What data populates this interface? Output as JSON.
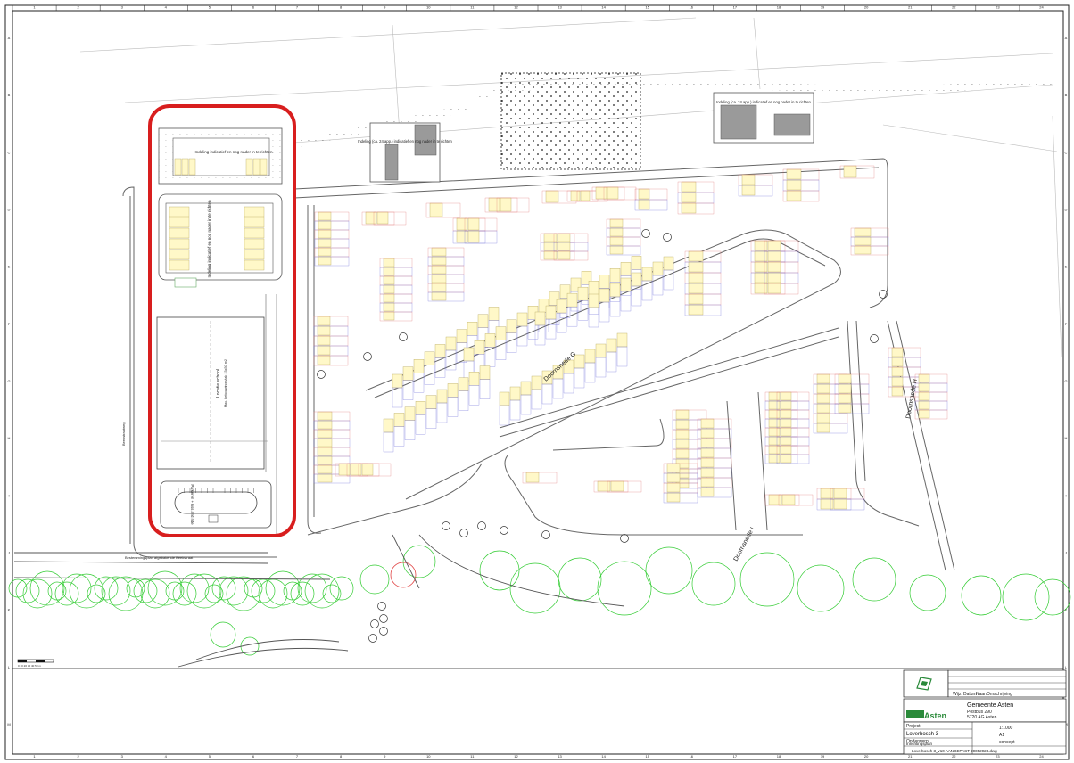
{
  "sheet": {
    "column_numbers": [
      "1",
      "2",
      "3",
      "4",
      "5",
      "6",
      "7",
      "8",
      "9",
      "10",
      "11",
      "12",
      "13",
      "14",
      "15",
      "16",
      "17",
      "18",
      "19",
      "20",
      "21",
      "22",
      "23",
      "24"
    ],
    "row_letters": [
      "A",
      "B",
      "C",
      "D",
      "E",
      "F",
      "G",
      "H",
      "I",
      "J",
      "K",
      "L",
      "M"
    ]
  },
  "labels": {
    "building_left_top": "Indeling indicatief en nog nader in te richten",
    "building_left_mid": "Indeling indicatief en nog nader in te richten",
    "school": "Locatie school",
    "school_sub": "Max. bebouwingsvlak 15x50 m2",
    "parking": "Parkeren + kiss and ride",
    "building_center": "Indeling (ca. 24 app.) indicatief en nog nader in te richten",
    "building_right": "Indeling (ca. 24 app.) indicatief en nog nader in te richten",
    "street_g": "Doornsnede G",
    "street_h": "Doornsnede H",
    "street_i": "Doornsnede I",
    "road_west": "Beekstraatweg",
    "road_south": "Bestemmingsplan afgebakende Beekstraat"
  },
  "title_block": {
    "municipality": "Gemeente Asten",
    "logo_text": "Asten",
    "project_label": "Project",
    "project": "Loverbosch 3",
    "content_label": "Onderwerp",
    "content": "Inrichtingsplan",
    "file": "Loverbosch 3_v10 AANGEPAST 20052023.dwg",
    "scale": "1:1000",
    "format": "A1",
    "status": "concept",
    "address_lines": [
      "Postbus 290",
      "5720 AG Asten"
    ],
    "revision_header": [
      "Wijz.",
      "Datum",
      "Naam",
      "Omschrijving"
    ]
  },
  "scalebar": {
    "label": "0   10   20   30   40   50 m"
  },
  "colors": {
    "highlight": "#d81e1e",
    "building_fill": "#fff8c8",
    "building_stroke": "#b8a860",
    "parcel_red": "#e07070",
    "parcel_blue": "#6a6ad8",
    "tree_green": "#33cc33",
    "logo_green": "#2a8a3a"
  }
}
